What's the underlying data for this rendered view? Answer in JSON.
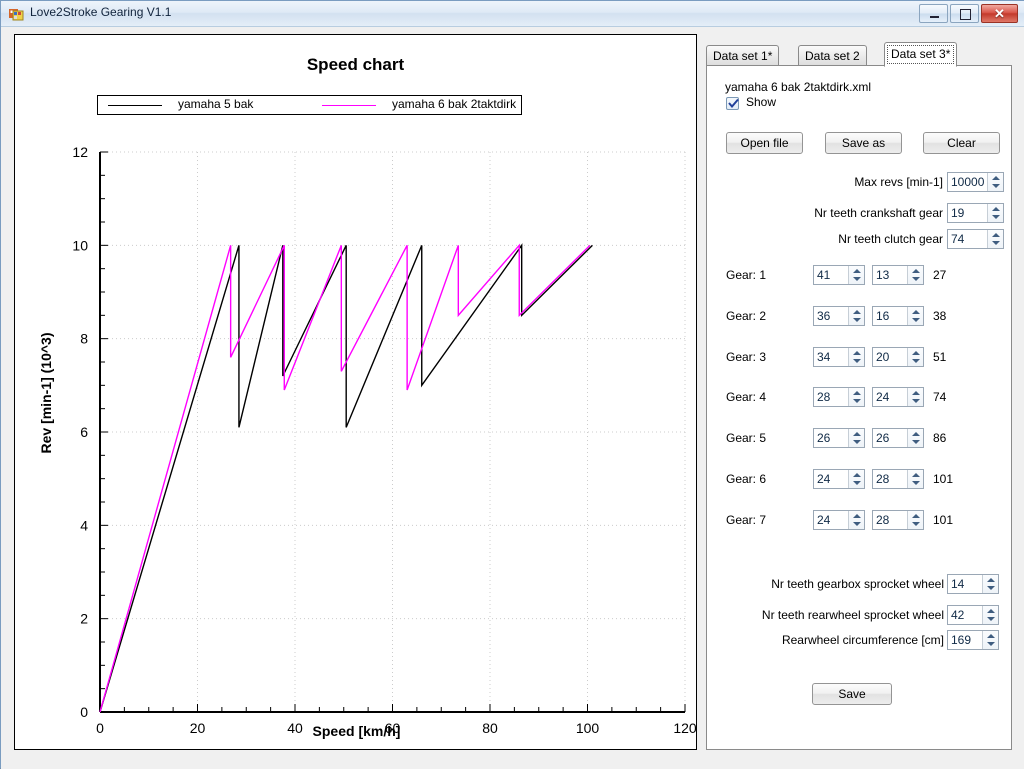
{
  "window": {
    "title": "Love2Stroke Gearing V1.1",
    "icon": "app-icon",
    "minimize_label": "",
    "maximize_label": "",
    "close_label": "✕"
  },
  "chart": {
    "title": "Speed chart",
    "legend": [
      {
        "label": "yamaha 5 bak",
        "color": "#000000"
      },
      {
        "label": "yamaha 6 bak 2taktdirk",
        "color": "#ff00ff"
      }
    ]
  },
  "chart_data": {
    "type": "line",
    "title": "Speed chart",
    "xlabel": "Speed [km/h]",
    "ylabel": "Rev [min-1] (10^3)",
    "xlim": [
      0,
      120
    ],
    "ylim": [
      0,
      12
    ],
    "xticks": [
      0,
      20,
      40,
      60,
      80,
      100,
      120
    ],
    "yticks": [
      0,
      2,
      4,
      6,
      8,
      10,
      12
    ],
    "x_minor_step": 5,
    "y_minor_step": 0.5,
    "grid": true,
    "legend_position": "top",
    "series": [
      {
        "name": "yamaha 5 bak",
        "color": "#000000",
        "gears": [
          {
            "gear": 1,
            "x": [
              0,
              28.5
            ],
            "y": [
              0,
              10
            ]
          },
          {
            "gear": 2,
            "x": [
              28.5,
              37.5
            ],
            "y": [
              6.1,
              10
            ]
          },
          {
            "gear": 3,
            "x": [
              37.5,
              50.5
            ],
            "y": [
              7.2,
              10
            ]
          },
          {
            "gear": 4,
            "x": [
              50.5,
              66
            ],
            "y": [
              6.1,
              10
            ]
          },
          {
            "gear": 5,
            "x": [
              66,
              86.5
            ],
            "y": [
              7.0,
              10
            ]
          },
          {
            "gear": 6,
            "x": [
              86.5,
              101
            ],
            "y": [
              8.5,
              10
            ]
          }
        ]
      },
      {
        "name": "yamaha 6 bak 2taktdirk",
        "color": "#ff00ff",
        "gears": [
          {
            "gear": 1,
            "x": [
              0,
              26.8
            ],
            "y": [
              0,
              10
            ]
          },
          {
            "gear": 2,
            "x": [
              26.8,
              37.8
            ],
            "y": [
              7.6,
              10
            ]
          },
          {
            "gear": 3,
            "x": [
              37.8,
              49.5
            ],
            "y": [
              6.9,
              10
            ]
          },
          {
            "gear": 4,
            "x": [
              49.5,
              63
            ],
            "y": [
              7.3,
              10
            ]
          },
          {
            "gear": 5,
            "x": [
              63,
              73.5
            ],
            "y": [
              6.9,
              10
            ]
          },
          {
            "gear": 6,
            "x": [
              73.5,
              86
            ],
            "y": [
              8.5,
              10
            ]
          },
          {
            "gear": 7,
            "x": [
              86,
              100.5
            ],
            "y": [
              8.5,
              10
            ]
          }
        ]
      }
    ]
  },
  "tabs": [
    {
      "label": "Data set 1*",
      "active": false
    },
    {
      "label": "Data set 2",
      "active": false
    },
    {
      "label": "Data set 3*",
      "active": true
    }
  ],
  "dataset": {
    "filename": "yamaha 6 bak 2taktdirk.xml",
    "show_label": "Show",
    "show_checked": true,
    "buttons": {
      "open_file": "Open file",
      "save_as": "Save as",
      "clear": "Clear",
      "save": "Save"
    },
    "fields": [
      {
        "label": "Max revs [min-1]",
        "value": "10000"
      },
      {
        "label": "Nr teeth crankshaft gear",
        "value": "19"
      },
      {
        "label": "Nr teeth clutch gear",
        "value": "74"
      }
    ],
    "gears": [
      {
        "label": "Gear: 1",
        "teeth_a": "41",
        "teeth_b": "13",
        "ratio": "27"
      },
      {
        "label": "Gear: 2",
        "teeth_a": "36",
        "teeth_b": "16",
        "ratio": "38"
      },
      {
        "label": "Gear: 3",
        "teeth_a": "34",
        "teeth_b": "20",
        "ratio": "51"
      },
      {
        "label": "Gear: 4",
        "teeth_a": "28",
        "teeth_b": "24",
        "ratio": "74"
      },
      {
        "label": "Gear: 5",
        "teeth_a": "26",
        "teeth_b": "26",
        "ratio": "86"
      },
      {
        "label": "Gear: 6",
        "teeth_a": "24",
        "teeth_b": "28",
        "ratio": "101"
      },
      {
        "label": "Gear: 7",
        "teeth_a": "24",
        "teeth_b": "28",
        "ratio": "101"
      }
    ],
    "bottom_fields": [
      {
        "label": "Nr teeth gearbox sprocket wheel",
        "value": "14"
      },
      {
        "label": "Nr teeth rearwheel sprocket wheel",
        "value": "42"
      },
      {
        "label": "Rearwheel circumference [cm]",
        "value": "169"
      }
    ]
  }
}
